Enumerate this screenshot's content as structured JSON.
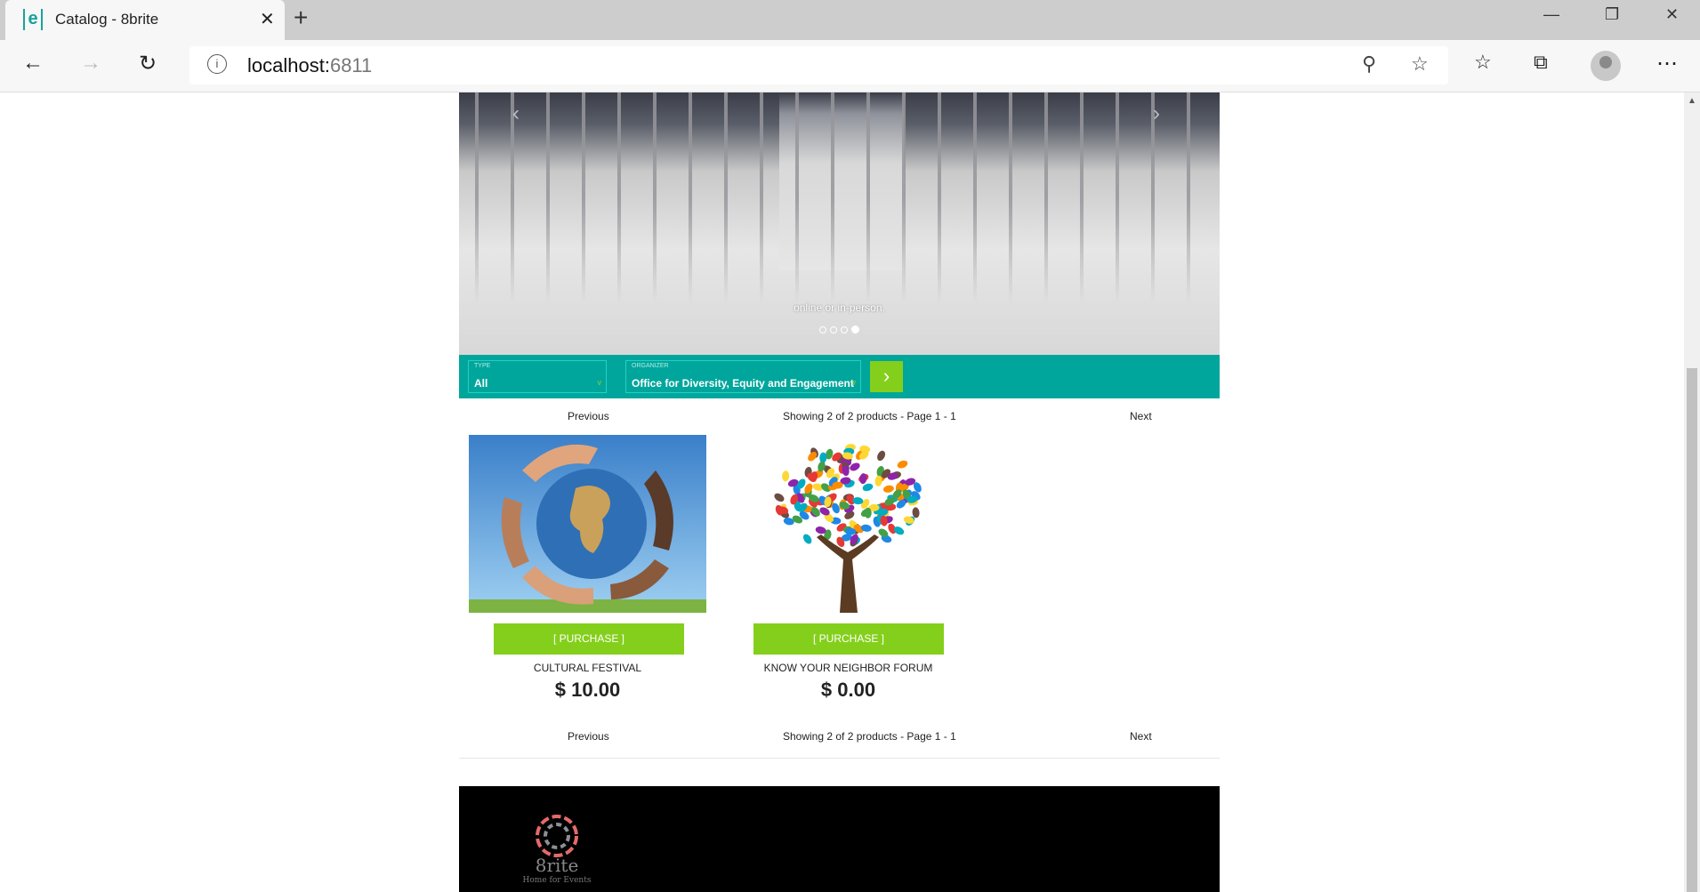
{
  "browser": {
    "tab_title": "Catalog - 8brite",
    "url_host": "localhost:",
    "url_port": "6811"
  },
  "hero": {
    "caption": "online or in-person.",
    "slide_count": 4,
    "active_slide": 4
  },
  "filters": {
    "type_label": "TYPE",
    "type_value": "All",
    "organizer_label": "ORGANIZER",
    "organizer_value": "Office for Diversity, Equity and Engagement"
  },
  "pagination": {
    "previous": "Previous",
    "summary": "Showing 2 of 2 products - Page 1 - 1",
    "next": "Next"
  },
  "products": [
    {
      "name": "CULTURAL FESTIVAL",
      "price": "$ 10.00",
      "button": "[ PURCHASE ]"
    },
    {
      "name": "KNOW YOUR NEIGHBOR FORUM",
      "price": "$ 0.00",
      "button": "[ PURCHASE ]"
    }
  ],
  "footer": {
    "logo_name": "8rite",
    "logo_tagline": "Home for Events"
  },
  "colors": {
    "teal": "#00a69c",
    "green": "#84cf1c"
  }
}
